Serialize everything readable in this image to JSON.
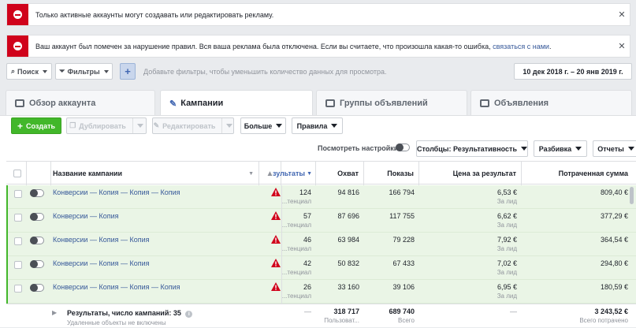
{
  "alerts": [
    {
      "text": "Только активные аккаунты могут создавать или редактировать рекламу."
    },
    {
      "text": "Ваш аккаунт был помечен за нарушение правил. Вся ваша реклама была отключена. Если вы считаете, что произошла какая-то ошибка, ",
      "link": "связаться с нами",
      "tail": "."
    }
  ],
  "filterbar": {
    "search_label": "Поиск",
    "filters_label": "Фильтры",
    "add_symbol": "+",
    "hint": "Добавьте фильтры, чтобы уменьшить количество данных для просмотра.",
    "date_range": "10 дек 2018 г. – 20 янв 2019 г."
  },
  "tabs": [
    {
      "label": "Обзор аккаунта"
    },
    {
      "label": "Кампании"
    },
    {
      "label": "Группы объявлений"
    },
    {
      "label": "Объявления"
    }
  ],
  "toolbar": {
    "create": "Создать",
    "duplicate": "Дублировать",
    "edit": "Редактировать",
    "more": "Больше",
    "rules": "Правила",
    "view_settings": "Посмотреть настройки",
    "columns": "Столбцы: Результативность",
    "breakdown": "Разбивка",
    "reports": "Отчеты"
  },
  "table": {
    "headers": {
      "name": "Название кампании",
      "results": "зультаты",
      "reach": "Охват",
      "impressions": "Показы",
      "cost_per_result": "Цена за результат",
      "spent": "Потраченная сумма"
    },
    "rows": [
      {
        "name": "Конверсии — Копия — Копия — Копия",
        "results": "124",
        "results_sub": "тенциал...",
        "reach": "94 816",
        "impressions": "166 794",
        "cpr": "6,53 €",
        "cpr_sub": "За лид",
        "spent": "809,40 €"
      },
      {
        "name": "Конверсии — Копия",
        "results": "57",
        "results_sub": "тенциал...",
        "reach": "87 696",
        "impressions": "117 755",
        "cpr": "6,62 €",
        "cpr_sub": "За лид",
        "spent": "377,29 €"
      },
      {
        "name": "Конверсии — Копия — Копия",
        "results": "46",
        "results_sub": "тенциал...",
        "reach": "63 984",
        "impressions": "79 228",
        "cpr": "7,92 €",
        "cpr_sub": "За лид",
        "spent": "364,54 €"
      },
      {
        "name": "Конверсии — Копия — Копия",
        "results": "42",
        "results_sub": "тенциал...",
        "reach": "50 832",
        "impressions": "67 433",
        "cpr": "7,02 €",
        "cpr_sub": "За лид",
        "spent": "294,80 €"
      },
      {
        "name": "Конверсии — Копия — Копия — Копия",
        "results": "26",
        "results_sub": "тенциал...",
        "reach": "33 160",
        "impressions": "39 106",
        "cpr": "6,95 €",
        "cpr_sub": "За лид",
        "spent": "180,59 €"
      }
    ],
    "footer": {
      "label": "Результаты, число кампаний: 35",
      "note": "Удаленные объекты не включены",
      "results": "—",
      "reach": "318 717",
      "reach_sub": "Пользоват...",
      "impressions": "689 740",
      "impressions_sub": "Всего",
      "cpr": "—",
      "spent": "3 243,52 €",
      "spent_sub": "Всего потрачено"
    }
  },
  "colors": {
    "accent": "#4267b2",
    "create": "#42b72a",
    "warning": "#d0021b",
    "row_bg": "#eaf5e6"
  }
}
